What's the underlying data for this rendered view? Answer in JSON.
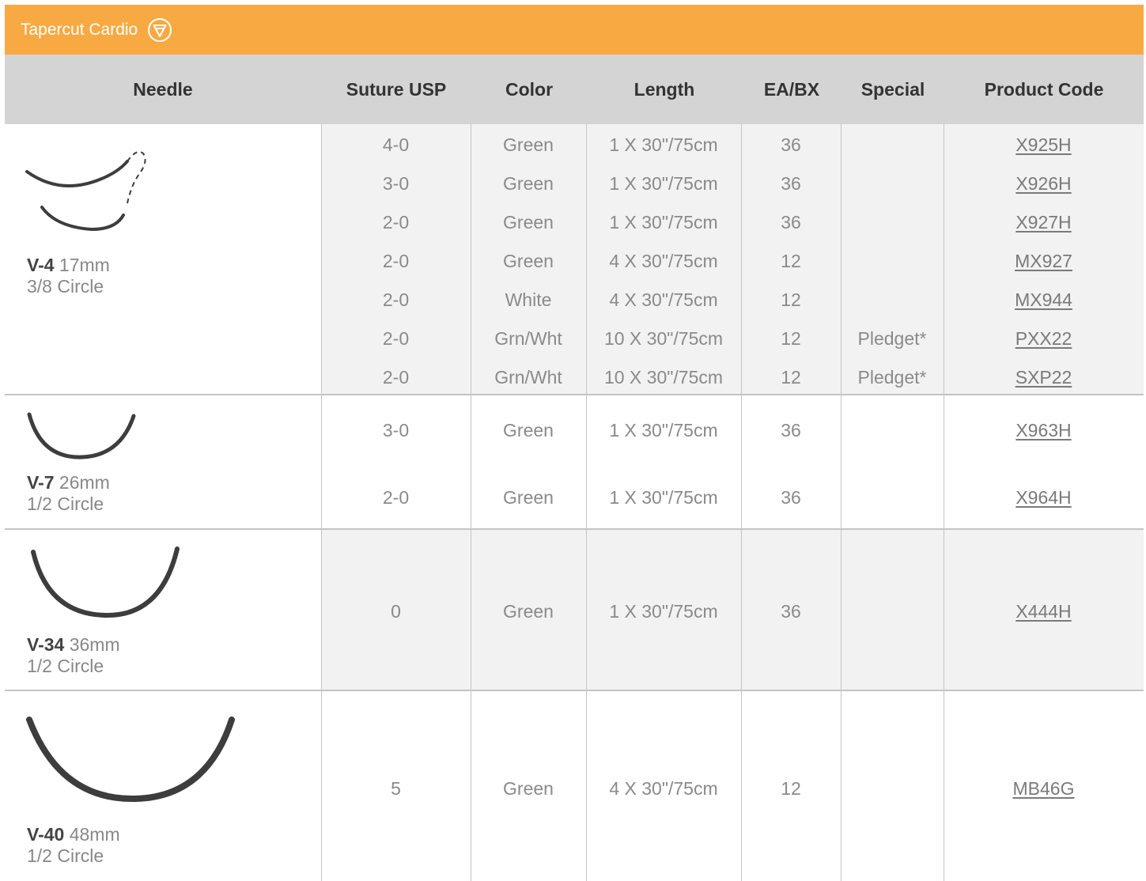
{
  "section": {
    "title": "Tapercut Cardio",
    "icon": "funnel-filter-icon",
    "accent_color": "#f9a942"
  },
  "columns": [
    "Needle",
    "Suture USP",
    "Color",
    "Length",
    "EA/BX",
    "Special",
    "Product Code"
  ],
  "groups": [
    {
      "needle": {
        "name": "V-4",
        "size": "17mm",
        "shape": "3/8 Circle",
        "icon": "double-curved-needle-icon"
      },
      "rows": [
        {
          "usp": "4-0",
          "color": "Green",
          "length": "1 X 30\"/75cm",
          "ea_bx": "36",
          "special": "",
          "code": "X925H"
        },
        {
          "usp": "3-0",
          "color": "Green",
          "length": "1 X 30\"/75cm",
          "ea_bx": "36",
          "special": "",
          "code": "X926H"
        },
        {
          "usp": "2-0",
          "color": "Green",
          "length": "1 X 30\"/75cm",
          "ea_bx": "36",
          "special": "",
          "code": "X927H"
        },
        {
          "usp": "2-0",
          "color": "Green",
          "length": "4 X 30\"/75cm",
          "ea_bx": "12",
          "special": "",
          "code": "MX927"
        },
        {
          "usp": "2-0",
          "color": "White",
          "length": "4 X 30\"/75cm",
          "ea_bx": "12",
          "special": "",
          "code": "MX944"
        },
        {
          "usp": "2-0",
          "color": "Grn/Wht",
          "length": "10 X 30\"/75cm",
          "ea_bx": "12",
          "special": "Pledget*",
          "code": "PXX22"
        },
        {
          "usp": "2-0",
          "color": "Grn/Wht",
          "length": "10 X 30\"/75cm",
          "ea_bx": "12",
          "special": "Pledget*",
          "code": "SXP22"
        }
      ]
    },
    {
      "needle": {
        "name": "V-7",
        "size": "26mm",
        "shape": "1/2 Circle",
        "icon": "half-circle-needle-icon"
      },
      "rows": [
        {
          "usp": "3-0",
          "color": "Green",
          "length": "1 X 30\"/75cm",
          "ea_bx": "36",
          "special": "",
          "code": "X963H"
        },
        {
          "usp": "2-0",
          "color": "Green",
          "length": "1 X 30\"/75cm",
          "ea_bx": "36",
          "special": "",
          "code": "X964H"
        }
      ]
    },
    {
      "needle": {
        "name": "V-34",
        "size": "36mm",
        "shape": "1/2 Circle",
        "icon": "half-circle-needle-icon"
      },
      "rows": [
        {
          "usp": "0",
          "color": "Green",
          "length": "1 X 30\"/75cm",
          "ea_bx": "36",
          "special": "",
          "code": "X444H"
        }
      ]
    },
    {
      "needle": {
        "name": "V-40",
        "size": "48mm",
        "shape": "1/2 Circle",
        "icon": "half-circle-needle-icon"
      },
      "rows": [
        {
          "usp": "5",
          "color": "Green",
          "length": "4 X 30\"/75cm",
          "ea_bx": "12",
          "special": "",
          "code": "MB46G"
        }
      ]
    }
  ]
}
